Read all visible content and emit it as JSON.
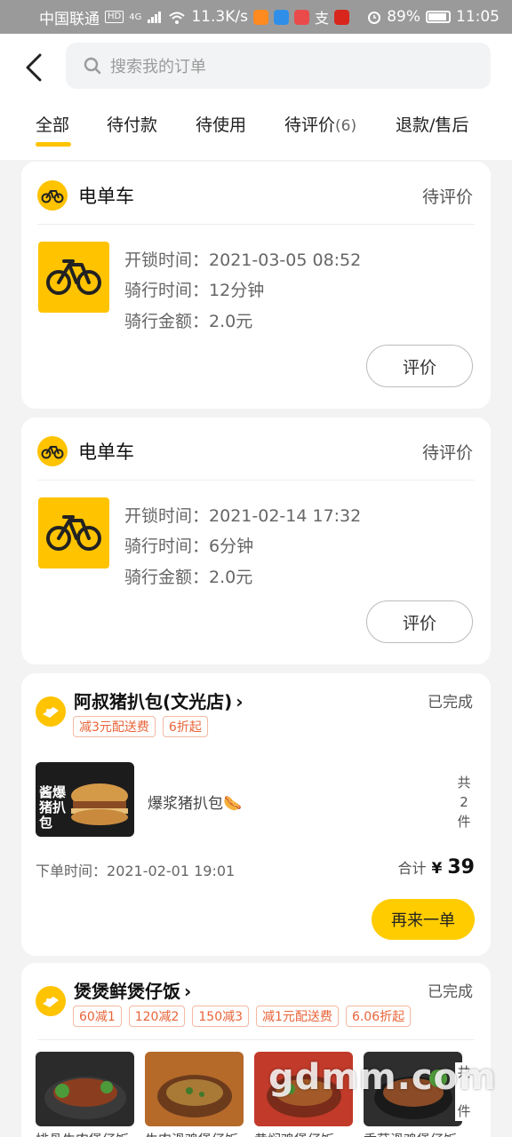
{
  "status_bar": {
    "carrier": "中国联通",
    "hd": "HD",
    "net_type": "4G",
    "speed": "11.3K/s",
    "battery": "89%",
    "time": "11:05"
  },
  "header": {
    "search_placeholder": "搜索我的订单"
  },
  "tabs": [
    {
      "label": "全部",
      "count": ""
    },
    {
      "label": "待付款",
      "count": ""
    },
    {
      "label": "待使用",
      "count": ""
    },
    {
      "label": "待评价",
      "count": "(6)"
    },
    {
      "label": "退款/售后",
      "count": ""
    }
  ],
  "bike_orders": [
    {
      "shop": "电单车",
      "status": "待评价",
      "unlock_label": "开锁时间：",
      "unlock_value": "2021-03-05 08:52",
      "ride_label": "骑行时间：",
      "ride_value": "12分钟",
      "amount_label": "骑行金额：",
      "amount_value": "2.0元",
      "button": "评价"
    },
    {
      "shop": "电单车",
      "status": "待评价",
      "unlock_label": "开锁时间：",
      "unlock_value": "2021-02-14 17:32",
      "ride_label": "骑行时间：",
      "ride_value": "6分钟",
      "amount_label": "骑行金额：",
      "amount_value": "2.0元",
      "button": "评价"
    }
  ],
  "food_orders": [
    {
      "shop": "阿叔猪扒包(文光店)",
      "status": "已完成",
      "tags": [
        "减3元配送费",
        "6折起"
      ],
      "dish": "爆浆猪扒包🌭",
      "dish_image_text": [
        "酱爆",
        "猪扒包"
      ],
      "count_chars": [
        "共",
        "2",
        "件"
      ],
      "time_label": "下单时间：",
      "time_value": "2021-02-01 19:01",
      "total_label": "合计",
      "currency": "¥",
      "total_value": "39",
      "button": "再来一单"
    },
    {
      "shop": "煲煲鲜煲仔饭",
      "status": "已完成",
      "tags": [
        "60减1",
        "120减2",
        "150减3",
        "减1元配送费",
        "6.06折起"
      ],
      "dishes": [
        "排骨牛肉煲仔饭",
        "牛肉滑鸡煲仔饭",
        "黄焖鸡煲仔饭",
        "香菇滑鸡煲仔饭"
      ],
      "count_chars": [
        "共",
        "件"
      ]
    }
  ],
  "watermark": "gdmm.com",
  "colors": {
    "accent": "#ffc300",
    "tag": "#e8643a",
    "button": "#ffcc00"
  }
}
